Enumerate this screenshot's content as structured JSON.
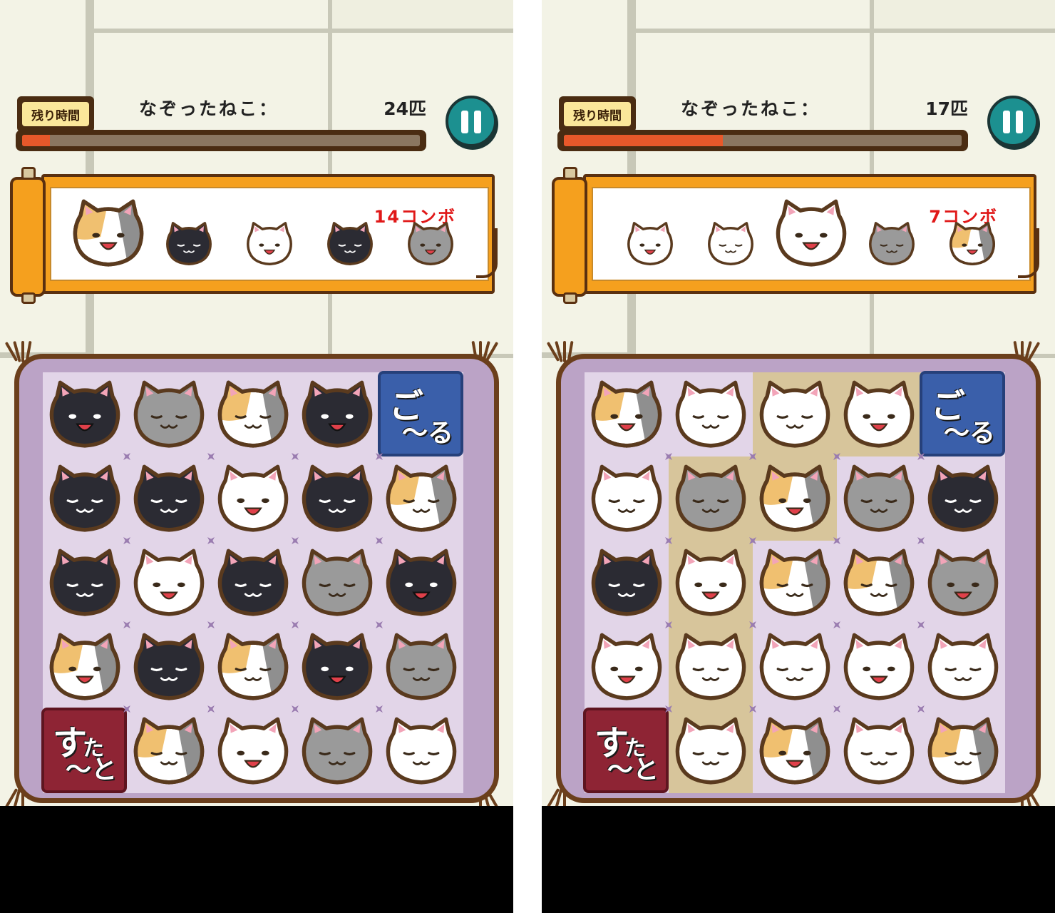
{
  "screens": [
    {
      "timer_label": "残り時間",
      "count_label": "なぞったねこ：",
      "count_value": "24匹",
      "timer_fraction": 0.07,
      "combo": "14コンボ",
      "chain_preview": [
        "calico",
        "black",
        "white",
        "black",
        "gray"
      ],
      "chain_big_index": 0,
      "grid": [
        [
          "black",
          "gray",
          "calico",
          "black",
          "goal"
        ],
        [
          "black",
          "black",
          "white",
          "black",
          "calico"
        ],
        [
          "black",
          "white",
          "black",
          "gray",
          "black"
        ],
        [
          "calico",
          "black",
          "calico",
          "black",
          "gray"
        ],
        [
          "start",
          "calico",
          "white",
          "gray",
          "white"
        ]
      ],
      "highlighted": [],
      "goal_label_1": "ご",
      "goal_label_2": "〜る",
      "start_label_1": "す",
      "start_label_2": "〜と",
      "start_label_3": "た"
    },
    {
      "timer_label": "残り時間",
      "count_label": "なぞったねこ：",
      "count_value": "17匹",
      "timer_fraction": 0.4,
      "combo": "7コンボ",
      "chain_preview": [
        "white",
        "white",
        "white",
        "gray",
        "calico"
      ],
      "chain_big_index": 2,
      "grid": [
        [
          "calico",
          "white",
          "white",
          "white",
          "goal"
        ],
        [
          "white",
          "gray",
          "calico",
          "gray",
          "black"
        ],
        [
          "black",
          "white",
          "calico",
          "calico",
          "gray"
        ],
        [
          "white",
          "white",
          "white",
          "white",
          "white"
        ],
        [
          "start",
          "white",
          "calico",
          "white",
          "calico"
        ]
      ],
      "highlighted": [
        [
          0,
          2
        ],
        [
          0,
          3
        ],
        [
          1,
          1
        ],
        [
          1,
          2
        ],
        [
          2,
          1
        ],
        [
          3,
          1
        ],
        [
          4,
          1
        ]
      ],
      "goal_label_1": "ご",
      "goal_label_2": "〜る",
      "start_label_1": "す",
      "start_label_2": "〜と",
      "start_label_3": "た"
    }
  ],
  "colors": {
    "black_cat": "#2b2b33",
    "gray_cat": "#9a9a9a",
    "white_cat": "#ffffff",
    "calico_orange": "#f0c070",
    "calico_gray": "#8f8f8f",
    "cat_outline": "#5a3a1e",
    "timer_fill": "#e8582a",
    "combo_text": "#e01818",
    "highlight_cell": "#d7c59b",
    "cushion": "#bba3c6",
    "board": "#e2d5e8"
  }
}
